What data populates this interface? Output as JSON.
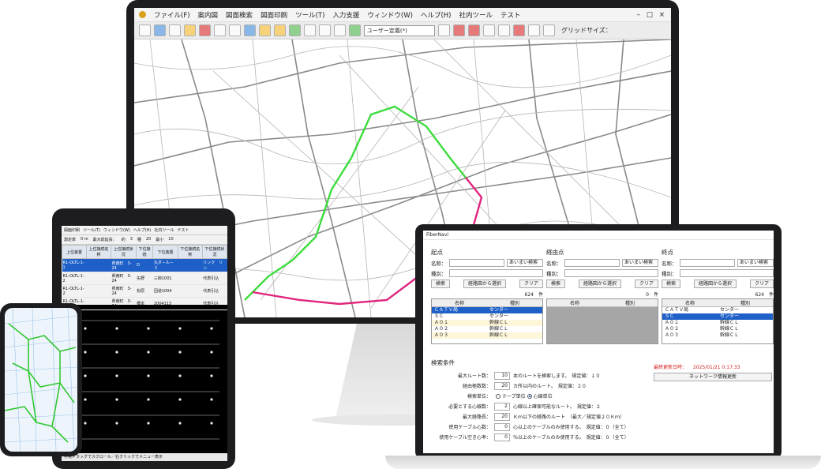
{
  "desktop": {
    "menu": [
      "ファイル(F)",
      "案内図",
      "図面検索",
      "図面印刷",
      "ツール(T)",
      "入力支援",
      "ウィンドウ(W)",
      "ヘルプ(H)",
      "社内ツール",
      "テスト"
    ],
    "window_controls": [
      "–",
      "□",
      "×"
    ],
    "toolbar_select": "ユーザー定義(*)",
    "toolbar_grid": "グリッドサイズ：",
    "route_colors": {
      "green": "#3ddc3d",
      "magenta": "#e0257f"
    }
  },
  "tablet": {
    "menu": [
      "図面印刷",
      "ツール(T)",
      "ウィンドウ(W)",
      "ヘルプ(H)",
      "社内ツール",
      "テスト"
    ],
    "toolbar": [
      "測定表",
      "0 m",
      "最大総延長：",
      "約",
      "3",
      "種",
      "20",
      "最小",
      "10"
    ],
    "headers": [
      "上位装置",
      "上位接続名称",
      "上位接続状況",
      "下位接続",
      "下位装置",
      "下位接続名称",
      "下位接続状況"
    ],
    "rows": [
      [
        "R1-OLTL-1-1",
        "",
        "県南町　3-24",
        "D",
        "丸ダ－ル－３",
        "",
        "リンク　リン"
      ],
      [
        "R1-OLTL-1-2",
        "",
        "県南町　3-24",
        "矢野",
        "三柳1001",
        "",
        "代表引込"
      ],
      [
        "R1-OLTL-1-2",
        "",
        "県南町　3-24",
        "松原",
        "団道1004",
        "",
        "代表引込"
      ],
      [
        "R1-OLTL-1-2",
        "",
        "県南町　3-24",
        "橋本",
        "2004113",
        "",
        "代表引込"
      ]
    ],
    "status": "中央ドラッグでスクロール／右クリックでメニュー表示"
  },
  "laptop": {
    "title": "FiberNavi",
    "panels": [
      {
        "heading": "起点",
        "name_label": "名称：",
        "kind_label": "種別：",
        "match": "あいまい検索",
        "search": "検索",
        "select_from_map": "経路図から選択",
        "clear": "クリア",
        "count": "624　件",
        "col_name": "名称",
        "col_kind": "種別",
        "rows": [
          [
            "ＣＡＴＶ局",
            "センター"
          ],
          [
            "ＳＣ",
            "センター"
          ],
          [
            "Ａ０１",
            "幹線ＣＬ"
          ],
          [
            "Ａ０２",
            "幹線ＣＬ"
          ],
          [
            "Ａ０３",
            "幹線ＣＬ"
          ]
        ]
      },
      {
        "heading": "経由点",
        "name_label": "名称：",
        "kind_label": "種別：",
        "match": "あいまい検索",
        "search": "検索",
        "select_from_map": "経路図から選択",
        "clear": "クリア",
        "count": "0　件",
        "col_name": "名称",
        "col_kind": "種別",
        "rows": []
      },
      {
        "heading": "終点",
        "name_label": "名称：",
        "kind_label": "種別：",
        "match": "あいまい検索",
        "search": "検索",
        "select_from_map": "経路図から選択",
        "clear": "クリア",
        "count": "624　件",
        "col_name": "名称",
        "col_kind": "種別",
        "rows": [
          [
            "ＣＡＴＶ局",
            "センター"
          ],
          [
            "ＳＣ",
            "センター"
          ],
          [
            "Ａ０１",
            "幹線ＣＬ"
          ],
          [
            "Ａ０２",
            "幹線ＣＬ"
          ],
          [
            "Ａ０３",
            "幹線ＣＬ"
          ]
        ]
      }
    ],
    "conditions": {
      "heading": "検索条件",
      "rows": [
        {
          "label": "最大ルート数：",
          "value": "10",
          "note": "本のルートを検索します。　規定値：１０"
        },
        {
          "label": "経由極数数：",
          "value": "20",
          "note": "カ所以内のルート。　規定値：２０"
        },
        {
          "label": "検索単位：",
          "value": "",
          "note": ""
        },
        {
          "label": "必要とする心線数：",
          "value": "2",
          "note": "心線以上確保可能なルート。　規定値：２"
        },
        {
          "label": "最大経路長：",
          "value": "20",
          "note": "Ｋｍ以下の経路のルート　（最大／規定値２０Ｋｍ）"
        },
        {
          "label": "使用ケーブル心数：",
          "value": "0",
          "note": "心以上のケーブルのみ使用する。　規定値：０（全て）"
        },
        {
          "label": "使用ケーブル空き心率：",
          "value": "0",
          "note": "％以上のケーブルのみ使用する。　規定値：０（全て）"
        }
      ],
      "unit_tape": "テープ単位",
      "unit_core": "心線単位"
    },
    "last_update_label": "最終更新日時：",
    "last_update_value": "2025/01/21 0:17:33",
    "network_update_button": "ネットワーク情報更新"
  }
}
